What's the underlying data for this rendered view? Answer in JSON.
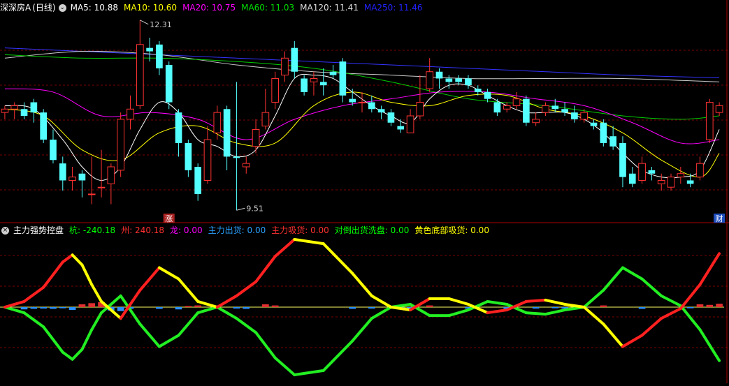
{
  "top_header": {
    "title": "深深房A",
    "period": "(日线)",
    "ma": [
      {
        "label": "MA5: 10.88",
        "color": "#ffffff"
      },
      {
        "label": "MA10: 10.60",
        "color": "#ffff00"
      },
      {
        "label": "MA20: 10.75",
        "color": "#ff00ff"
      },
      {
        "label": "MA60: 11.03",
        "color": "#00dd00"
      },
      {
        "label": "MA120: 11.41",
        "color": "#dddddd"
      },
      {
        "label": "MA250: 11.46",
        "color": "#2222ff"
      }
    ]
  },
  "price_labels": {
    "high": "12.31",
    "low": "9.51"
  },
  "markers": {
    "zhang": "涨",
    "cai": "财"
  },
  "bottom_header": {
    "title": "主力强势控盘",
    "items": [
      {
        "label": "杭: -240.18",
        "color": "#00ff00"
      },
      {
        "label": "州: 240.18",
        "color": "#ff3030"
      },
      {
        "label": "龙: 0.00",
        "color": "#ff00ff"
      },
      {
        "label": "主力出货: 0.00",
        "color": "#2aa0ff"
      },
      {
        "label": "主力吸货: 0.00",
        "color": "#ff3030"
      },
      {
        "label": "对倒出货洗盘: 0.00",
        "color": "#00ff00"
      },
      {
        "label": "黄色底部吸货: 0.00",
        "color": "#ffff00"
      }
    ]
  },
  "colors": {
    "up": "#ff3232",
    "down": "#54ffff",
    "grid": "#7a0000",
    "ma5": "#ffffff",
    "ma10": "#ffff00",
    "ma20": "#ff00ff",
    "ma60": "#00cc00",
    "ma120": "#cccccc",
    "ma250": "#3333ff"
  },
  "chart_data": [
    {
      "type": "candlestick",
      "ylim": [
        9.4,
        12.4
      ],
      "candles": [
        [
          10.95,
          11.0,
          10.85,
          11.05
        ],
        [
          11.0,
          11.05,
          10.85,
          11.1
        ],
        [
          11.0,
          10.9,
          10.85,
          11.1
        ],
        [
          11.1,
          10.95,
          10.8,
          11.15
        ],
        [
          10.95,
          10.55,
          10.5,
          11.0
        ],
        [
          10.55,
          10.25,
          10.2,
          10.7
        ],
        [
          10.2,
          9.95,
          9.8,
          10.3
        ],
        [
          9.95,
          10.0,
          9.8,
          10.15
        ],
        [
          10.05,
          9.95,
          9.7,
          10.1
        ],
        [
          9.75,
          9.75,
          9.6,
          10.3
        ],
        [
          9.85,
          9.85,
          9.7,
          10.4
        ],
        [
          9.9,
          10.15,
          9.6,
          10.2
        ],
        [
          10.1,
          10.85,
          10.0,
          10.95
        ],
        [
          10.85,
          11.0,
          10.7,
          11.2
        ],
        [
          11.05,
          11.95,
          11.0,
          12.31
        ],
        [
          11.9,
          11.85,
          11.7,
          12.05
        ],
        [
          11.95,
          11.6,
          11.5,
          12.0
        ],
        [
          11.65,
          11.1,
          11.0,
          11.7
        ],
        [
          10.95,
          10.5,
          10.3,
          11.0
        ],
        [
          10.5,
          10.1,
          10.0,
          10.55
        ],
        [
          10.15,
          9.75,
          9.65,
          10.2
        ],
        [
          9.95,
          10.55,
          9.9,
          10.75
        ],
        [
          10.65,
          10.95,
          10.55,
          11.05
        ],
        [
          11.0,
          10.3,
          10.1,
          11.05
        ],
        [
          10.3,
          10.28,
          9.51,
          11.4
        ],
        [
          10.15,
          10.2,
          10.05,
          10.3
        ],
        [
          10.45,
          10.7,
          10.35,
          10.85
        ],
        [
          10.75,
          10.95,
          10.7,
          11.3
        ],
        [
          11.1,
          11.45,
          11.0,
          11.55
        ],
        [
          11.5,
          11.75,
          11.4,
          11.85
        ],
        [
          11.9,
          11.55,
          11.45,
          12.0
        ],
        [
          11.45,
          11.25,
          11.2,
          11.5
        ],
        [
          11.4,
          11.45,
          11.2,
          11.55
        ],
        [
          11.4,
          11.35,
          11.2,
          11.6
        ],
        [
          11.55,
          11.5,
          11.45,
          11.65
        ],
        [
          11.7,
          11.2,
          11.1,
          11.75
        ],
        [
          11.15,
          11.1,
          11.05,
          11.3
        ],
        [
          11.1,
          11.1,
          10.95,
          11.25
        ],
        [
          11.1,
          11.0,
          10.95,
          11.2
        ],
        [
          11.0,
          10.95,
          10.85,
          11.05
        ],
        [
          10.95,
          10.8,
          10.75,
          11.0
        ],
        [
          10.75,
          10.7,
          10.65,
          10.85
        ],
        [
          10.65,
          10.9,
          10.65,
          11.0
        ],
        [
          10.9,
          11.1,
          10.85,
          11.5
        ],
        [
          11.3,
          11.55,
          11.25,
          11.75
        ],
        [
          11.55,
          11.45,
          11.3,
          11.6
        ],
        [
          11.45,
          11.4,
          11.3,
          11.5
        ],
        [
          11.45,
          11.4,
          11.35,
          11.5
        ],
        [
          11.45,
          11.35,
          11.3,
          11.5
        ],
        [
          11.3,
          11.25,
          11.2,
          11.35
        ],
        [
          11.25,
          11.15,
          11.1,
          11.3
        ],
        [
          11.1,
          10.95,
          10.9,
          11.15
        ],
        [
          11.0,
          11.05,
          10.95,
          11.1
        ],
        [
          11.05,
          11.15,
          11.0,
          11.25
        ],
        [
          11.15,
          10.8,
          10.75,
          11.2
        ],
        [
          10.8,
          10.85,
          10.75,
          10.95
        ],
        [
          10.95,
          11.05,
          10.9,
          11.1
        ],
        [
          11.05,
          11.0,
          10.95,
          11.15
        ],
        [
          11.0,
          10.95,
          10.9,
          11.1
        ],
        [
          10.95,
          10.85,
          10.8,
          11.05
        ],
        [
          10.85,
          10.95,
          10.8,
          11.0
        ],
        [
          10.8,
          10.75,
          10.7,
          10.85
        ],
        [
          10.8,
          10.5,
          10.45,
          10.85
        ],
        [
          10.6,
          10.45,
          10.4,
          10.75
        ],
        [
          10.5,
          10.0,
          9.85,
          10.6
        ],
        [
          10.05,
          9.9,
          9.85,
          10.15
        ],
        [
          9.95,
          10.2,
          9.9,
          10.3
        ],
        [
          10.1,
          10.05,
          9.95,
          10.15
        ],
        [
          9.9,
          9.95,
          9.8,
          10.05
        ],
        [
          9.85,
          10.0,
          9.8,
          10.05
        ],
        [
          10.0,
          10.05,
          9.9,
          10.15
        ],
        [
          9.95,
          9.9,
          9.85,
          10.05
        ],
        [
          10.0,
          10.2,
          9.95,
          10.3
        ],
        [
          10.55,
          11.1,
          10.5,
          11.15
        ],
        [
          10.95,
          11.05,
          10.9,
          11.1
        ]
      ],
      "ma": {
        "ma5": [
          [
            0,
            11.05
          ],
          [
            3,
            11.0
          ],
          [
            6,
            10.55
          ],
          [
            8,
            10.15
          ],
          [
            10,
            9.95
          ],
          [
            12,
            10.15
          ],
          [
            14,
            10.7
          ],
          [
            16,
            11.1
          ],
          [
            18,
            10.95
          ],
          [
            20,
            10.55
          ],
          [
            22,
            10.45
          ],
          [
            24,
            10.3
          ],
          [
            26,
            10.4
          ],
          [
            28,
            10.9
          ],
          [
            30,
            11.45
          ],
          [
            32,
            11.5
          ],
          [
            34,
            11.45
          ],
          [
            36,
            11.25
          ],
          [
            38,
            11.05
          ],
          [
            40,
            10.9
          ],
          [
            42,
            10.8
          ],
          [
            44,
            11.15
          ],
          [
            46,
            11.35
          ],
          [
            48,
            11.35
          ],
          [
            50,
            11.2
          ],
          [
            52,
            11.05
          ],
          [
            54,
            10.95
          ],
          [
            56,
            10.95
          ],
          [
            58,
            10.95
          ],
          [
            60,
            10.85
          ],
          [
            62,
            10.65
          ],
          [
            64,
            10.35
          ],
          [
            66,
            10.1
          ],
          [
            68,
            10.0
          ],
          [
            70,
            10.0
          ],
          [
            72,
            10.1
          ],
          [
            74,
            10.7
          ]
        ],
        "ma10": [
          [
            0,
            11.0
          ],
          [
            4,
            10.9
          ],
          [
            8,
            10.4
          ],
          [
            12,
            10.25
          ],
          [
            16,
            10.65
          ],
          [
            20,
            10.75
          ],
          [
            24,
            10.5
          ],
          [
            28,
            10.5
          ],
          [
            32,
            11.05
          ],
          [
            36,
            11.25
          ],
          [
            40,
            11.1
          ],
          [
            44,
            11.05
          ],
          [
            48,
            11.2
          ],
          [
            52,
            11.2
          ],
          [
            56,
            11.0
          ],
          [
            60,
            10.9
          ],
          [
            64,
            10.65
          ],
          [
            68,
            10.25
          ],
          [
            72,
            10.0
          ],
          [
            74,
            10.35
          ]
        ],
        "ma20": [
          [
            0,
            11.3
          ],
          [
            5,
            11.25
          ],
          [
            10,
            10.9
          ],
          [
            15,
            10.95
          ],
          [
            20,
            10.85
          ],
          [
            25,
            10.55
          ],
          [
            30,
            10.85
          ],
          [
            35,
            11.05
          ],
          [
            40,
            11.15
          ],
          [
            45,
            11.25
          ],
          [
            50,
            11.25
          ],
          [
            55,
            11.15
          ],
          [
            60,
            11.05
          ],
          [
            65,
            10.8
          ],
          [
            70,
            10.5
          ],
          [
            74,
            10.55
          ]
        ],
        "ma60": [
          [
            0,
            11.8
          ],
          [
            8,
            11.75
          ],
          [
            16,
            11.75
          ],
          [
            24,
            11.7
          ],
          [
            32,
            11.6
          ],
          [
            40,
            11.4
          ],
          [
            48,
            11.15
          ],
          [
            56,
            11.05
          ],
          [
            64,
            10.9
          ],
          [
            70,
            10.85
          ],
          [
            74,
            10.9
          ]
        ],
        "ma120": [
          [
            0,
            11.75
          ],
          [
            8,
            11.85
          ],
          [
            16,
            11.8
          ],
          [
            24,
            11.65
          ],
          [
            32,
            11.55
          ],
          [
            40,
            11.5
          ],
          [
            48,
            11.45
          ],
          [
            56,
            11.45
          ],
          [
            64,
            11.45
          ],
          [
            74,
            11.4
          ]
        ],
        "ma250": [
          [
            0,
            11.9
          ],
          [
            8,
            11.85
          ],
          [
            16,
            11.8
          ],
          [
            24,
            11.75
          ],
          [
            32,
            11.7
          ],
          [
            40,
            11.65
          ],
          [
            48,
            11.6
          ],
          [
            56,
            11.55
          ],
          [
            64,
            11.5
          ],
          [
            74,
            11.46
          ]
        ]
      }
    },
    {
      "type": "line",
      "ylim": [
        -260,
        260
      ],
      "series": [
        {
          "name": "杭",
          "values": [
            [
              0,
              0
            ],
            [
              2,
              -20
            ],
            [
              4,
              -70
            ],
            [
              6,
              -160
            ],
            [
              7,
              -185
            ],
            [
              8,
              -150
            ],
            [
              9,
              -80
            ],
            [
              10,
              -20
            ],
            [
              12,
              40
            ],
            [
              14,
              -60
            ],
            [
              16,
              -140
            ],
            [
              18,
              -100
            ],
            [
              20,
              -20
            ],
            [
              22,
              0
            ],
            [
              24,
              -40
            ],
            [
              26,
              -90
            ],
            [
              28,
              -180
            ],
            [
              30,
              -240.18
            ],
            [
              33,
              -225
            ],
            [
              36,
              -120
            ],
            [
              38,
              -40
            ],
            [
              40,
              0
            ],
            [
              42,
              10
            ],
            [
              44,
              -30
            ],
            [
              46,
              -30
            ],
            [
              48,
              -10
            ],
            [
              50,
              20
            ],
            [
              52,
              10
            ],
            [
              54,
              -20
            ],
            [
              56,
              -25
            ],
            [
              58,
              -10
            ],
            [
              60,
              0
            ],
            [
              62,
              60
            ],
            [
              64,
              140
            ],
            [
              66,
              100
            ],
            [
              68,
              40
            ],
            [
              70,
              5
            ],
            [
              72,
              -80
            ],
            [
              74,
              -190
            ]
          ]
        },
        {
          "name": "州",
          "values": [
            [
              0,
              0
            ],
            [
              2,
              20
            ],
            [
              4,
              70
            ],
            [
              6,
              160
            ],
            [
              7,
              185
            ],
            [
              8,
              150
            ],
            [
              9,
              80
            ],
            [
              10,
              20
            ],
            [
              12,
              -40
            ],
            [
              14,
              60
            ],
            [
              16,
              140
            ],
            [
              18,
              100
            ],
            [
              20,
              20
            ],
            [
              22,
              0
            ],
            [
              24,
              40
            ],
            [
              26,
              90
            ],
            [
              28,
              180
            ],
            [
              30,
              240.18
            ],
            [
              33,
              225
            ],
            [
              36,
              120
            ],
            [
              38,
              40
            ],
            [
              40,
              0
            ],
            [
              42,
              -10
            ],
            [
              44,
              30
            ],
            [
              46,
              30
            ],
            [
              48,
              10
            ],
            [
              50,
              -20
            ],
            [
              52,
              -10
            ],
            [
              54,
              20
            ],
            [
              56,
              25
            ],
            [
              58,
              10
            ],
            [
              60,
              0
            ],
            [
              62,
              -60
            ],
            [
              64,
              -140
            ],
            [
              66,
              -100
            ],
            [
              68,
              -40
            ],
            [
              70,
              -5
            ],
            [
              72,
              80
            ],
            [
              74,
              190
            ]
          ]
        }
      ]
    }
  ]
}
